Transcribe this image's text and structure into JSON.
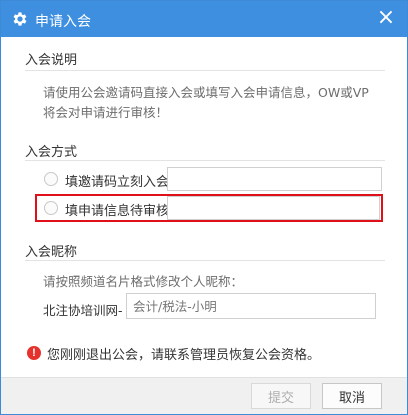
{
  "dialog": {
    "title": "申请入会",
    "close_icon": "×",
    "colors": {
      "titlebar": "#3e8fe0",
      "highlight": "#e0101b",
      "warning": "#e5322d"
    }
  },
  "section_instructions": {
    "title": "入会说明",
    "text": "请使用公会邀请码直接入会或填写入会申请信息，OW或VP将会对申请进行审核！"
  },
  "section_method": {
    "title": "入会方式",
    "options": [
      {
        "label": "填邀请码立刻入会",
        "value": "",
        "selected": false
      },
      {
        "label": "填申请信息待审核",
        "value": "",
        "selected": false
      }
    ]
  },
  "section_nickname": {
    "title": "入会昵称",
    "hint": "请按照频道名片格式修改个人昵称：",
    "prefix": "北注协培训网-",
    "placeholder": "会计/税法-小明"
  },
  "warning": {
    "icon": "!",
    "text": "您刚刚退出公会，请联系管理员恢复公会资格。"
  },
  "footer": {
    "submit_label": "提交",
    "cancel_label": "取消"
  }
}
